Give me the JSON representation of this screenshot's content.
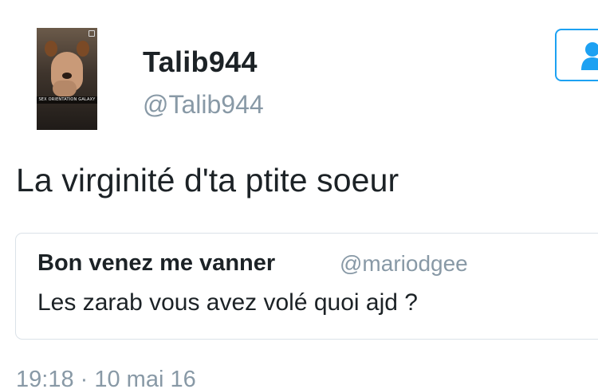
{
  "author": {
    "display_name": "Talib944",
    "handle": "@Talib944",
    "avatar_caption": "SEX ORIENTATION GALAXY"
  },
  "follow_button": {
    "icon": "follow-user-icon",
    "accent_color": "#1da1f2"
  },
  "tweet": {
    "text": "La virginité d'ta ptite soeur",
    "timestamp": "19:18 · 10 mai 16"
  },
  "quoted_tweet": {
    "display_name": "Bon venez me vanner",
    "handle": "@mariodgee",
    "text": "Les zarab vous avez volé quoi ajd ?"
  },
  "colors": {
    "text_primary": "#1c2226",
    "text_secondary": "#8899a6",
    "border": "#dbe2e8"
  }
}
